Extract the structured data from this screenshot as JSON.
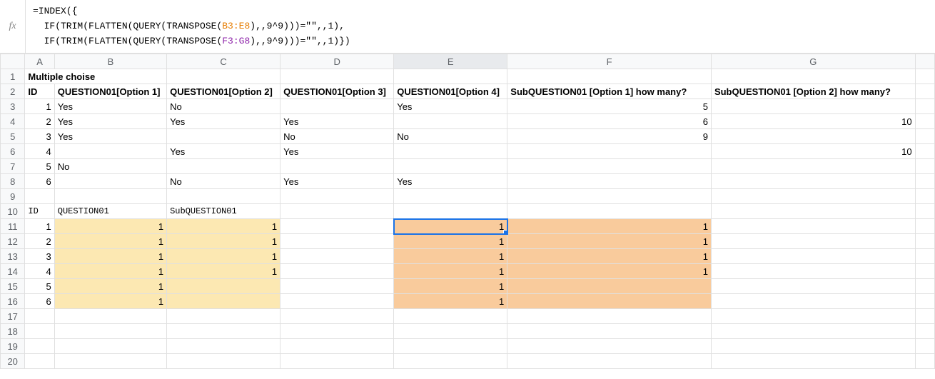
{
  "formula_bar": {
    "fx_label": "fx",
    "line1_prefix": "=INDEX({",
    "line2_a": "  IF(TRIM(FLATTEN(QUERY(TRANSPOSE(",
    "line2_range": "B3:E8",
    "line2_b": "),,9^9)))=\"\",,1),",
    "line3_a": "  IF(TRIM(FLATTEN(QUERY(TRANSPOSE(",
    "line3_range": "F3:G8",
    "line3_b": "),,9^9)))=\"\",,1)})"
  },
  "columns": {
    "A": "A",
    "B": "B",
    "C": "C",
    "D": "D",
    "E": "E",
    "F": "F",
    "G": "G"
  },
  "widths": {
    "A": 44,
    "B": 158,
    "C": 160,
    "D": 160,
    "E": 160,
    "F": 290,
    "G": 290
  },
  "row_numbers": [
    "1",
    "2",
    "3",
    "4",
    "5",
    "6",
    "7",
    "8",
    "9",
    "10",
    "11",
    "12",
    "13",
    "14",
    "15",
    "16",
    "17",
    "18",
    "19",
    "20"
  ],
  "r1": {
    "A": "Multiple choise"
  },
  "r2": {
    "A": "ID",
    "B": "QUESTION01[Option 1]",
    "C": "QUESTION01[Option 2]",
    "D": "QUESTION01[Option 3]",
    "E": "QUESTION01[Option 4]",
    "F": "SubQUESTION01 [Option 1] how many?",
    "G": "SubQUESTION01 [Option 2] how many?"
  },
  "r3": {
    "A": "1",
    "B": "Yes",
    "C": "No",
    "E": "Yes",
    "F": "5"
  },
  "r4": {
    "A": "2",
    "B": "Yes",
    "C": "Yes",
    "D": "Yes",
    "F": "6",
    "G": "10"
  },
  "r5": {
    "A": "3",
    "B": "Yes",
    "D": "No",
    "E": "No",
    "F": "9"
  },
  "r6": {
    "A": "4",
    "C": "Yes",
    "D": "Yes",
    "G": "10"
  },
  "r7": {
    "A": "5",
    "B": "No"
  },
  "r8": {
    "A": "6",
    "C": "No",
    "D": "Yes",
    "E": "Yes"
  },
  "r10": {
    "A": "ID",
    "B": "QUESTION01",
    "C": "SubQUESTION01"
  },
  "r11": {
    "A": "1",
    "B": "1",
    "C": "1",
    "E": "1",
    "F": "1"
  },
  "r12": {
    "A": "2",
    "B": "1",
    "C": "1",
    "E": "1",
    "F": "1"
  },
  "r13": {
    "A": "3",
    "B": "1",
    "C": "1",
    "E": "1",
    "F": "1"
  },
  "r14": {
    "A": "4",
    "B": "1",
    "C": "1",
    "E": "1",
    "F": "1"
  },
  "r15": {
    "A": "5",
    "B": "1",
    "E": "1"
  },
  "r16": {
    "A": "6",
    "B": "1",
    "E": "1"
  }
}
